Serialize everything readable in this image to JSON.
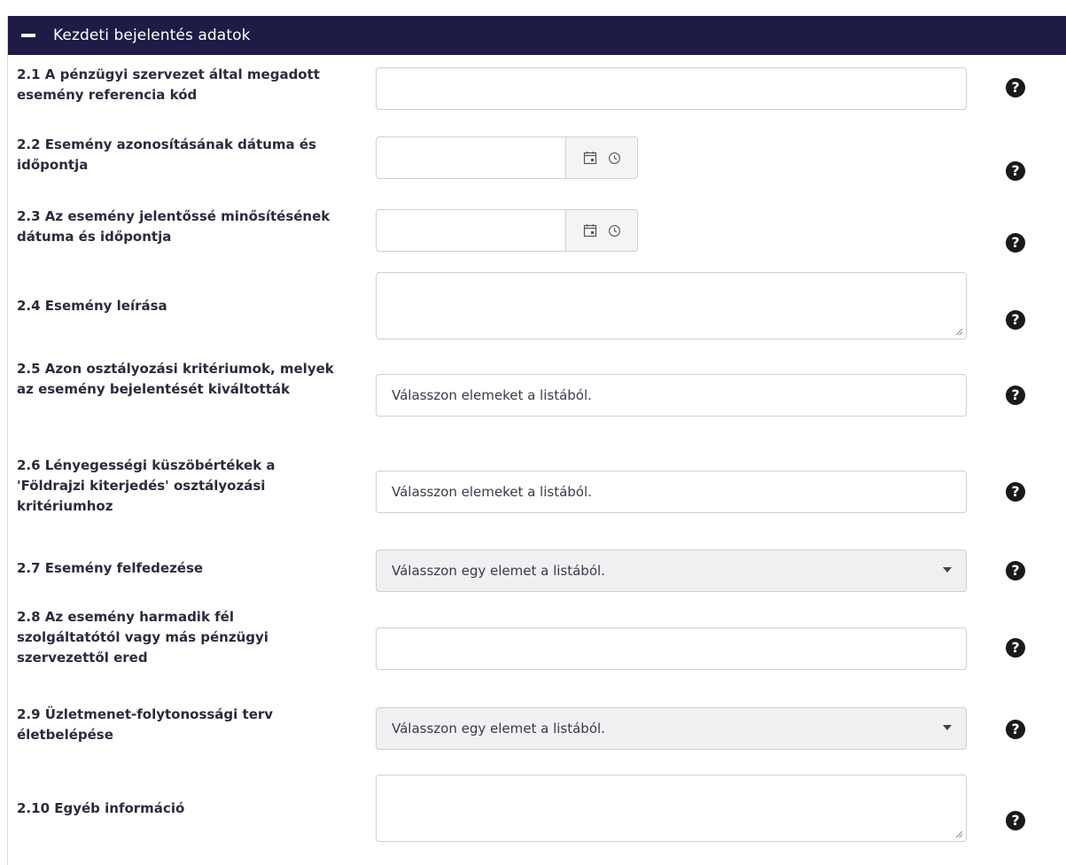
{
  "panel": {
    "title": "Kezdeti bejelentés adatok"
  },
  "fields": [
    {
      "label": "2.1 A pénzügyi szervezet által megadott esemény referencia kód",
      "value": ""
    },
    {
      "label": "2.2 Esemény azonosításának dátuma és időpontja",
      "value": ""
    },
    {
      "label": "2.3 Az esemény jelentőssé minősítésének dátuma és időpontja",
      "value": ""
    },
    {
      "label": "2.4 Esemény leírása",
      "value": ""
    },
    {
      "label": "2.5 Azon osztályozási kritériumok, melyek az esemény bejelentését kiváltották",
      "placeholder": "Válasszon elemeket a listából."
    },
    {
      "label": "2.6 Lényegességi küszöbértékek a 'Földrajzi kiterjedés' osztályozási kritériumhoz",
      "placeholder": "Válasszon elemeket a listából."
    },
    {
      "label": "2.7 Esemény felfedezése",
      "placeholder": "Válasszon egy elemet a listából."
    },
    {
      "label": "2.8 Az esemény harmadik fél szolgáltatótól vagy más pénzügyi szervezettől ered",
      "value": ""
    },
    {
      "label": "2.9 Üzletmenet-folytonossági terv életbelépése",
      "placeholder": "Válasszon egy elemet a listából."
    },
    {
      "label": "2.10 Egyéb információ",
      "value": ""
    }
  ],
  "help_icon": {
    "glyph": "?",
    "icon": "question-circle-icon"
  },
  "icons": {
    "calendar": "calendar-icon",
    "clock": "clock-icon",
    "collapse": "minus-icon",
    "dropdown": "caret-down-icon"
  },
  "colors": {
    "header_bg": "#1e1b47",
    "header_text": "#ffffff",
    "select_bg": "#f0f0f2",
    "border": "#cfcfd6"
  }
}
